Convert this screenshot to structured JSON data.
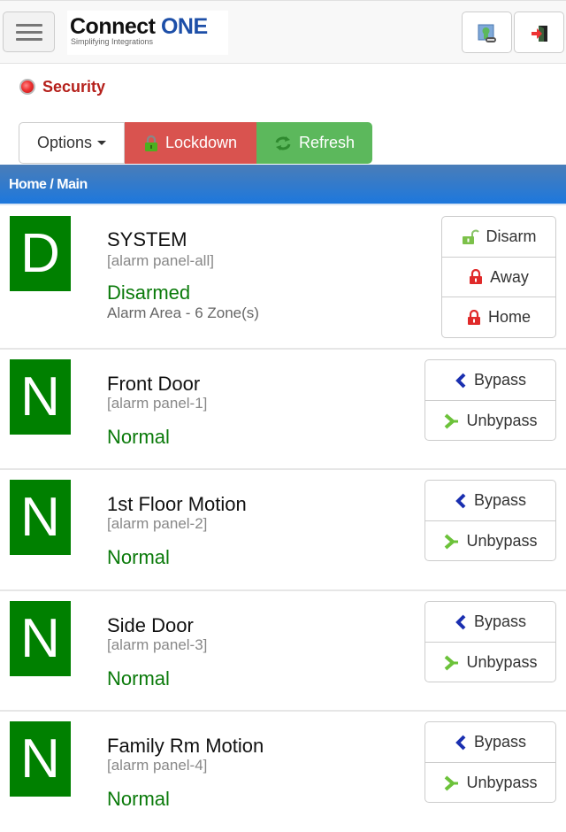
{
  "header": {
    "menu_icon": "hamburger-icon",
    "logo_main": "Connect",
    "logo_accent": "ONE",
    "logo_tagline": "Simplifying Integrations",
    "buttons": [
      {
        "icon": "picture-link-icon"
      },
      {
        "icon": "logout-icon"
      }
    ]
  },
  "section": {
    "icon": "alarm-bell-icon",
    "title": "Security"
  },
  "toolbar": {
    "options_label": "Options",
    "lockdown_label": "Lockdown",
    "refresh_label": "Refresh"
  },
  "breadcrumb": "Home / Main",
  "colors": {
    "accent_blue": "#1d78dd",
    "lockdown_red": "#d9534f",
    "refresh_green": "#5cb85c",
    "status_green": "#008000",
    "section_red": "#b5201b"
  },
  "system": {
    "badge": "D",
    "name": "SYSTEM",
    "panel": "[alarm panel-all]",
    "state": "Disarmed",
    "detail": "Alarm Area - 6 Zone(s)",
    "buttons": [
      {
        "label": "Disarm",
        "icon": "unlock-icon"
      },
      {
        "label": "Away",
        "icon": "lock-icon"
      },
      {
        "label": "Home",
        "icon": "lock-icon"
      }
    ]
  },
  "zones": [
    {
      "badge": "N",
      "name": "Front Door",
      "panel": "[alarm panel-1]",
      "state": "Normal",
      "bypass_label": "Bypass",
      "unbypass_label": "Unbypass"
    },
    {
      "badge": "N",
      "name": "1st Floor Motion",
      "panel": "[alarm panel-2]",
      "state": "Normal",
      "bypass_label": "Bypass",
      "unbypass_label": "Unbypass"
    },
    {
      "badge": "N",
      "name": "Side Door",
      "panel": "[alarm panel-3]",
      "state": "Normal",
      "bypass_label": "Bypass",
      "unbypass_label": "Unbypass"
    },
    {
      "badge": "N",
      "name": "Family Rm Motion",
      "panel": "[alarm panel-4]",
      "state": "Normal",
      "bypass_label": "Bypass",
      "unbypass_label": "Unbypass"
    }
  ]
}
